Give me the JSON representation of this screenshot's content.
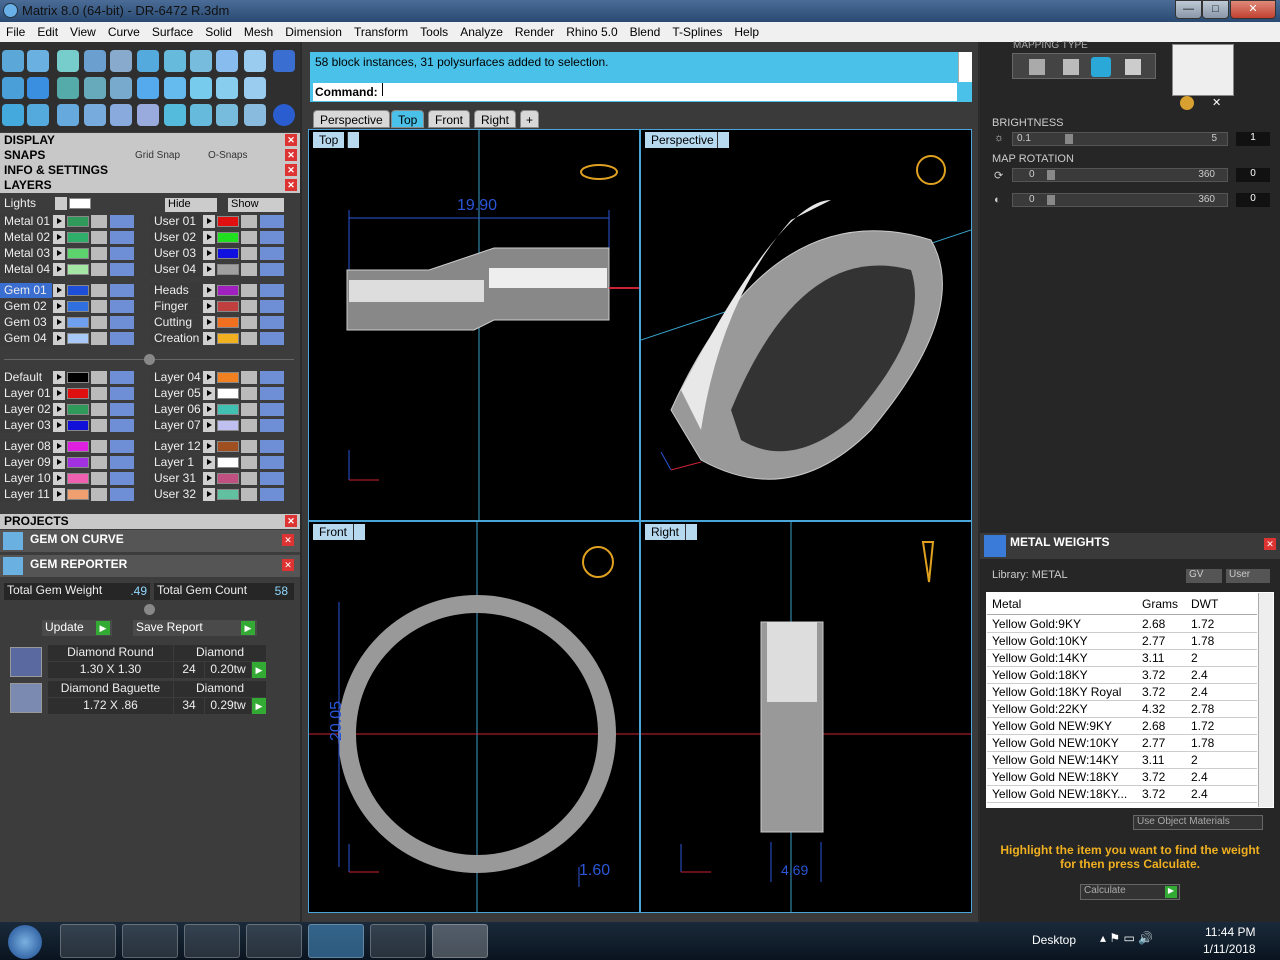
{
  "window": {
    "title": "Matrix 8.0 (64-bit) - DR-6472 R.3dm",
    "minimize_label": "—",
    "maximize_label": "□",
    "close_label": "✕"
  },
  "menu": [
    "File",
    "Edit",
    "View",
    "Curve",
    "Surface",
    "Solid",
    "Mesh",
    "Dimension",
    "Transform",
    "Tools",
    "Analyze",
    "Render",
    "Rhino 5.0",
    "Blend",
    "T-Splines",
    "Help"
  ],
  "command": {
    "message": "58 block instances, 31 polysurfaces added to selection.",
    "prompt": "Command:"
  },
  "view_tabs": [
    "Perspective",
    "Top",
    "Front",
    "Right"
  ],
  "active_tab": "Top",
  "panels": {
    "display": "DISPLAY",
    "snaps": "SNAPS",
    "grid_snap": "Grid Snap",
    "osnaps": "O-Snaps",
    "info": "INFO & SETTINGS",
    "layers": "LAYERS",
    "projects": "PROJECTS",
    "gem_on_curve": "GEM ON CURVE",
    "gem_reporter": "GEM REPORTER"
  },
  "layers_toolbar": {
    "lights": "Lights",
    "hide": "Hide",
    "show": "Show"
  },
  "layers_left": [
    {
      "name": "Metal 01",
      "color": "#2f9a5a"
    },
    {
      "name": "Metal 02",
      "color": "#2fae6a"
    },
    {
      "name": "Metal 03",
      "color": "#5cd36c"
    },
    {
      "name": "Metal 04",
      "color": "#a4e6a4"
    },
    {
      "name": "Gem 01",
      "color": "#1e4fd8"
    },
    {
      "name": "Gem 02",
      "color": "#2f6fe0"
    },
    {
      "name": "Gem 03",
      "color": "#6f9fef"
    },
    {
      "name": "Gem 04",
      "color": "#a8c8f5"
    },
    {
      "name": "Default",
      "color": "#000000"
    },
    {
      "name": "Layer 01",
      "color": "#e01010"
    },
    {
      "name": "Layer 02",
      "color": "#2f9a5a"
    },
    {
      "name": "Layer 03",
      "color": "#1010d8"
    },
    {
      "name": "Layer 08",
      "color": "#e020e0"
    },
    {
      "name": "Layer 09",
      "color": "#a030e0"
    },
    {
      "name": "Layer 10",
      "color": "#f060b0"
    },
    {
      "name": "Layer 11",
      "color": "#f0a070"
    }
  ],
  "layers_right": [
    {
      "name": "User 01",
      "color": "#e01010"
    },
    {
      "name": "User 02",
      "color": "#20e020"
    },
    {
      "name": "User 03",
      "color": "#1010e0"
    },
    {
      "name": "User 04",
      "color": "#a0a0a0"
    },
    {
      "name": "Heads",
      "color": "#a020c0"
    },
    {
      "name": "Finger",
      "color": "#c04040"
    },
    {
      "name": "Cutting",
      "color": "#f07020"
    },
    {
      "name": "Creation",
      "color": "#f0b020"
    },
    {
      "name": "Layer 04",
      "color": "#f08020"
    },
    {
      "name": "Layer 05",
      "color": "#ffffff"
    },
    {
      "name": "Layer 06",
      "color": "#40c0b0"
    },
    {
      "name": "Layer 07",
      "color": "#c0c0f0"
    },
    {
      "name": "Layer 12",
      "color": "#a05020"
    },
    {
      "name": "Layer 1",
      "color": "#ffffff"
    },
    {
      "name": "User 31",
      "color": "#c05080"
    },
    {
      "name": "User 32",
      "color": "#60c0a0"
    }
  ],
  "gem_reporter": {
    "total_weight_label": "Total Gem Weight",
    "total_weight": ".49",
    "total_count_label": "Total Gem Count",
    "total_count": "58",
    "update": "Update",
    "save_report": "Save Report",
    "gems": [
      {
        "name": "Diamond Round",
        "size": "1.30 X 1.30",
        "type": "Diamond",
        "count": "24",
        "weight": "0.20tw"
      },
      {
        "name": "Diamond Baguette",
        "size": "1.72 X .86",
        "type": "Diamond",
        "count": "34",
        "weight": "0.29tw"
      }
    ]
  },
  "viewports": {
    "top": {
      "label": "Top",
      "dim": "19.90"
    },
    "perspective": {
      "label": "Perspective"
    },
    "front": {
      "label": "Front",
      "dim1": "20.05",
      "dim2": "1.60"
    },
    "right": {
      "label": "Right",
      "dim": "4.69"
    }
  },
  "right_panel": {
    "mapping_type": "MAPPING TYPE",
    "brightness": "BRIGHTNESS",
    "b_min": "0.1",
    "b_max": "5",
    "b_val": "1",
    "map_rotation": "MAP ROTATION",
    "rot1": {
      "min": "0",
      "max": "360",
      "val": "0"
    },
    "rot2": {
      "min": "0",
      "max": "360",
      "val": "0"
    },
    "metal_weights": "METAL WEIGHTS",
    "library": "Library: METAL",
    "gv": "GV",
    "user": "User",
    "headers": [
      "Metal",
      "Grams",
      "DWT"
    ],
    "rows": [
      [
        "Yellow Gold:9KY",
        "2.68",
        "1.72"
      ],
      [
        "Yellow Gold:10KY",
        "2.77",
        "1.78"
      ],
      [
        "Yellow Gold:14KY",
        "3.11",
        "2"
      ],
      [
        "Yellow Gold:18KY",
        "3.72",
        "2.4"
      ],
      [
        "Yellow Gold:18KY Royal",
        "3.72",
        "2.4"
      ],
      [
        "Yellow Gold:22KY",
        "4.32",
        "2.78"
      ],
      [
        "Yellow Gold NEW:9KY",
        "2.68",
        "1.72"
      ],
      [
        "Yellow Gold NEW:10KY",
        "2.77",
        "1.78"
      ],
      [
        "Yellow Gold NEW:14KY",
        "3.11",
        "2"
      ],
      [
        "Yellow Gold NEW:18KY",
        "3.72",
        "2.4"
      ],
      [
        "Yellow Gold NEW:18KY...",
        "3.72",
        "2.4"
      ]
    ],
    "use_object_materials": "Use Object Materials",
    "hint": "Highlight the item you want to find the weight for then press Calculate.",
    "calculate": "Calculate"
  },
  "taskbar": {
    "desktop": "Desktop",
    "time": "11:44 PM",
    "date": "1/11/2018"
  }
}
